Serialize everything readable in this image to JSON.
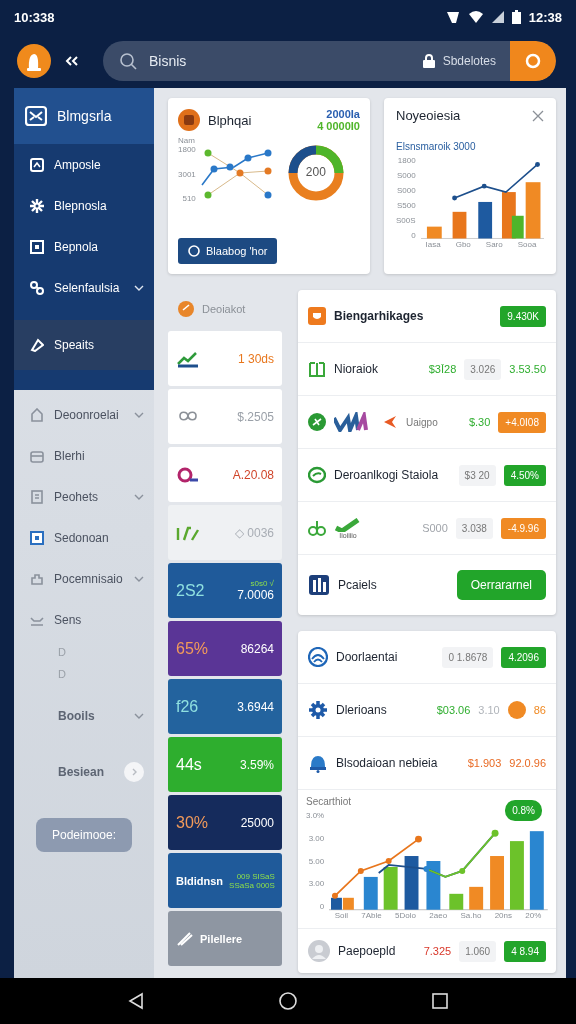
{
  "status_bar": {
    "time": "10:338",
    "clock": "12:38"
  },
  "header": {
    "search": {
      "value": "Bisnis"
    },
    "account": "Sbdelotes"
  },
  "sidebar": {
    "title": "Blmgsrla",
    "items": [
      {
        "label": "Amposle",
        "selected": false,
        "expandable": false
      },
      {
        "label": "Blepnosla",
        "selected": false,
        "expandable": false
      },
      {
        "label": "Bepnola",
        "selected": false,
        "expandable": false
      },
      {
        "label": "Selenfaulsia",
        "selected": false,
        "expandable": true
      },
      {
        "label": "Speaits",
        "selected": true,
        "expandable": false
      }
    ],
    "more_items": [
      {
        "label": "Deoonroelai",
        "selected": false,
        "expandable": true
      },
      {
        "label": "Blerhi",
        "selected": false,
        "expandable": false
      },
      {
        "label": "Peohets",
        "selected": false,
        "expandable": true
      },
      {
        "label": "Sedonoan",
        "selected": false,
        "expandable": false
      },
      {
        "label": "Pocemnisaio",
        "selected": false,
        "expandable": true
      },
      {
        "label": "Sens",
        "selected": false,
        "expandable": false
      }
    ],
    "sub_items": [
      "D",
      "D"
    ],
    "extra": [
      {
        "label": "Booils",
        "kind": "chevron"
      },
      {
        "label": "Besiean",
        "kind": "toggle"
      }
    ],
    "button": "Podeimooe:"
  },
  "summary_card": {
    "title": "Blphqai",
    "figures": [
      "2000Ia",
      "4 0000I0"
    ],
    "axis_title": "Nam",
    "y_labels": [
      "1800",
      "3001",
      "510"
    ],
    "donut_label": "200",
    "button": "Blaabog 'hor"
  },
  "chart_card": {
    "title": "Noyeoiesia",
    "subtitle": "Elsnsmaroik 3000",
    "y_labels": [
      "1800",
      "S000",
      "S000",
      "S500",
      "S00S",
      "0"
    ],
    "x_labels": [
      "Iasa",
      "Gbo",
      "Saro",
      "Sooa"
    ]
  },
  "tiles_title": "Deoiakot",
  "tiles": [
    {
      "kind": "light",
      "value": "1 30ds",
      "color": "#e8761c"
    },
    {
      "kind": "light",
      "value": "$.2505",
      "color": "#9aa0a8"
    },
    {
      "kind": "light",
      "value": "A.20.08",
      "color": "#d0452a"
    },
    {
      "kind": "light",
      "value": "◇ 0036",
      "color": "#a8adb4"
    },
    {
      "kind": "dark",
      "big": "2S2",
      "note": "s0s0 √",
      "value": "7.0006",
      "color": "#1f5a9a"
    },
    {
      "kind": "dark",
      "big": "65%",
      "value": "86264",
      "color": "#5a3596"
    },
    {
      "kind": "dark",
      "big": "f26",
      "value": "3.6944",
      "color": "#23639e"
    },
    {
      "kind": "dark",
      "big": "44s",
      "value": "3.59%",
      "color": "#2eae2e"
    },
    {
      "kind": "dark",
      "big": "30%",
      "value": "25000",
      "color": "#152b5c"
    },
    {
      "kind": "label",
      "big": "Bldidnsn",
      "note": "009 SISaS",
      "value": "SSaSa 000S",
      "color": "#1f5a9a"
    },
    {
      "kind": "faded",
      "big": "Pilellere",
      "color": "#8e96a2"
    }
  ],
  "list_card": {
    "title": "Biengarhikages",
    "badge": "9.430K",
    "rows": [
      {
        "name": "Nioraiok",
        "cells": [
          {
            "kind": "text",
            "text": "$3Ī28",
            "color": "#2fae2f"
          },
          {
            "kind": "pill",
            "text": "3.026"
          },
          {
            "kind": "text",
            "text": "3.53.50",
            "color": "#2fae2f"
          }
        ]
      },
      {
        "name": "Uaigpo",
        "cells": [
          {
            "kind": "text",
            "text": "$.30",
            "color": "#2fae2f"
          },
          {
            "kind": "badge",
            "text": "+4.0I08",
            "color": "#f08a24"
          }
        ]
      },
      {
        "name": "Deroanlkogi Staiola",
        "cells": [
          {
            "kind": "pill",
            "text": "$3 20"
          },
          {
            "kind": "badge",
            "text": "4.50%",
            "color": "#22a52a"
          }
        ]
      },
      {
        "name": "Iioiiiio",
        "cells": [
          {
            "kind": "text",
            "text": "S000",
            "color": "#a0a4aa"
          },
          {
            "kind": "pill",
            "text": "3.038"
          },
          {
            "kind": "badge",
            "text": "-4.9.96",
            "color": "#f08a24"
          }
        ]
      }
    ],
    "footer": {
      "name": "Pcaiels",
      "button": "Oerrararnel"
    }
  },
  "stats_card": {
    "rows": [
      {
        "name": "Doorlaentai",
        "cells": [
          {
            "kind": "pill",
            "text": "0 1.8678"
          },
          {
            "kind": "badge",
            "text": "4.2096",
            "color": "#22a52a"
          }
        ]
      },
      {
        "name": "Dlerioans",
        "cells": [
          {
            "kind": "text",
            "text": "$03.06",
            "color": "#2fae2f"
          },
          {
            "kind": "text",
            "text": "3.10",
            "color": "#b0b4ba"
          },
          {
            "kind": "dot",
            "text": "86",
            "color": "#f08a24"
          }
        ]
      },
      {
        "name": "Blsodaioan nebieia",
        "cells": [
          {
            "kind": "text",
            "text": "$1.903",
            "color": "#e86a24"
          },
          {
            "kind": "text",
            "text": "92.0.96",
            "color": "#e86a24"
          }
        ]
      }
    ],
    "chart": {
      "title": "Secarthiot",
      "badge": "0.8%",
      "y_labels": [
        "3.0%",
        "3.00",
        "5.00",
        "3.00",
        "0"
      ],
      "x_labels": [
        "Soil",
        "7Able",
        "5Dolo",
        "2aeo",
        "Sa.ho",
        "20ns",
        "20%"
      ]
    },
    "last_row": {
      "name": "Paepoepld",
      "cells": [
        {
          "kind": "text",
          "text": "7.325",
          "color": "#d9382a"
        },
        {
          "kind": "pill",
          "text": "1.060"
        },
        {
          "kind": "badge",
          "text": "4 8.94",
          "color": "#22a52a"
        }
      ]
    }
  }
}
